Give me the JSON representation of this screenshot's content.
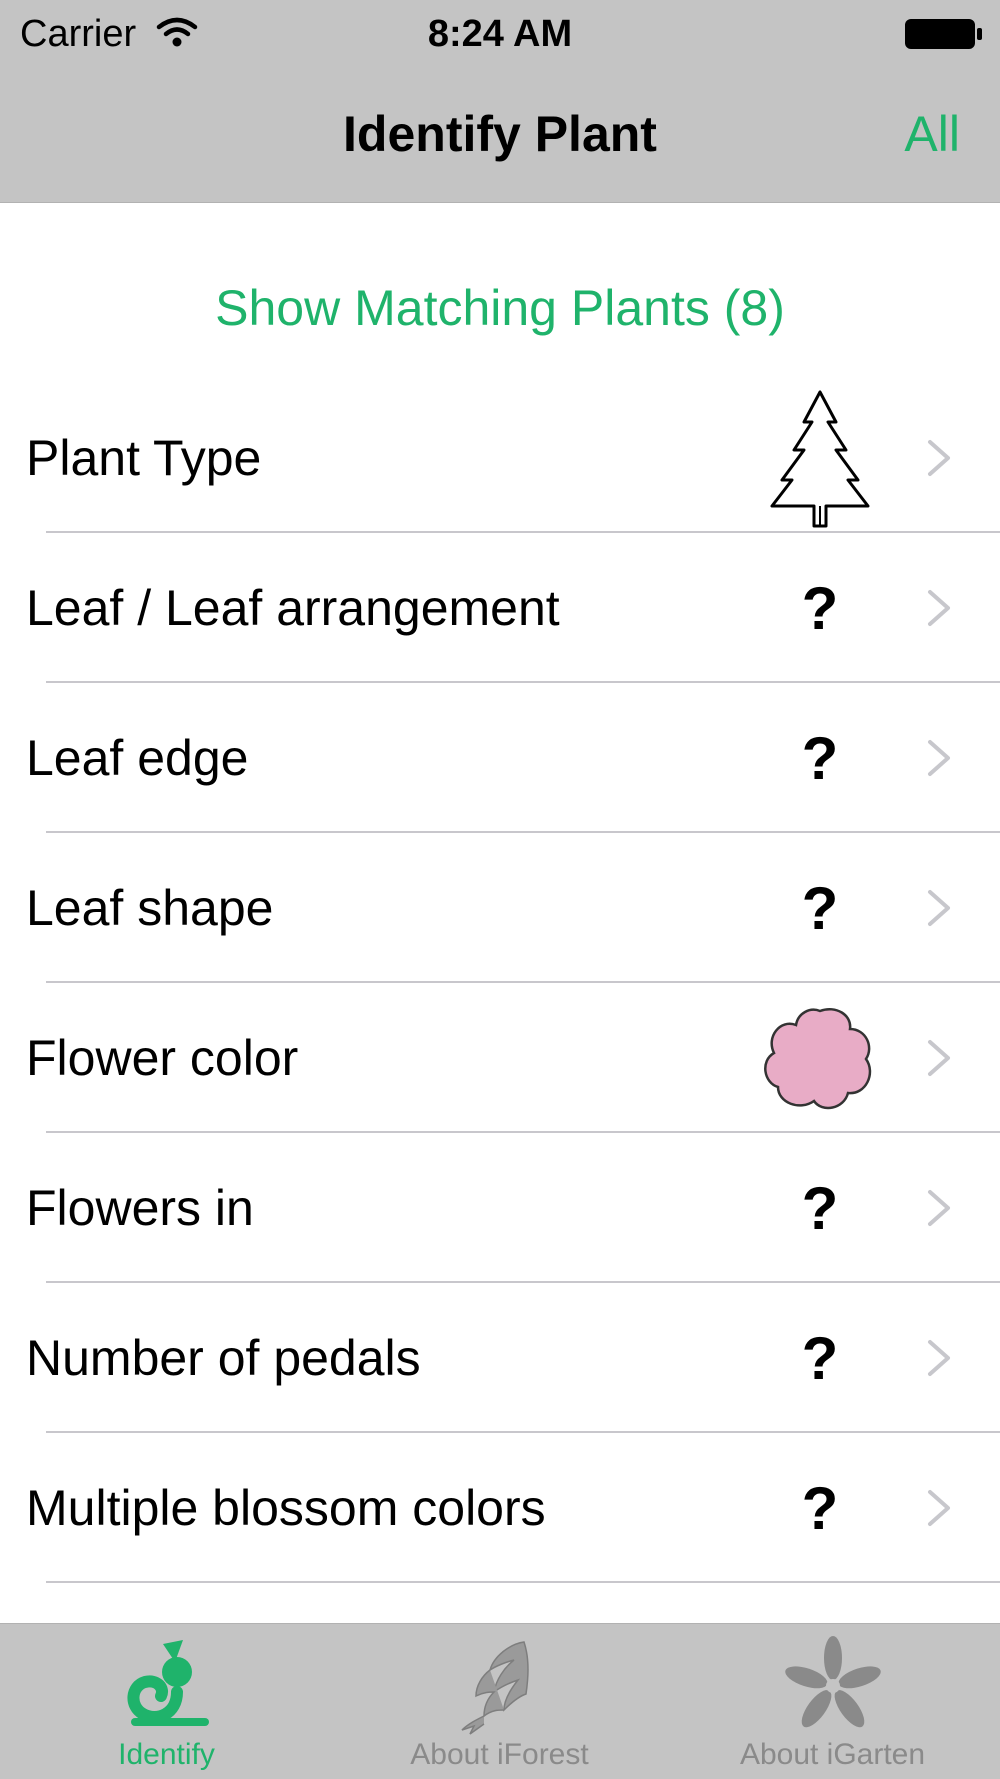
{
  "status_bar": {
    "carrier": "Carrier",
    "time": "8:24 AM"
  },
  "nav": {
    "title": "Identify Plant",
    "right_button": "All"
  },
  "show_matching_label": "Show Matching Plants (8)",
  "rows": [
    {
      "label": "Plant Type",
      "value_icon": "tree-icon"
    },
    {
      "label": "Leaf / Leaf arrangement",
      "value": "?"
    },
    {
      "label": "Leaf edge",
      "value": "?"
    },
    {
      "label": "Leaf shape",
      "value": "?"
    },
    {
      "label": "Flower color",
      "value_icon": "pink-flower-icon"
    },
    {
      "label": "Flowers in",
      "value": "?"
    },
    {
      "label": "Number of pedals",
      "value": "?"
    },
    {
      "label": "Multiple blossom colors",
      "value": "?"
    }
  ],
  "tabs": [
    {
      "label": "Identify",
      "icon": "identify-icon",
      "selected": true
    },
    {
      "label": "About iForest",
      "icon": "pinecone-icon",
      "selected": false
    },
    {
      "label": "About iGarten",
      "icon": "flower-icon",
      "selected": false
    }
  ],
  "colors": {
    "accent": "#1fb36b",
    "bar_background": "#c4c4c4",
    "flower_pink": "#e8acc6",
    "tab_inactive": "#8a8a8a"
  }
}
